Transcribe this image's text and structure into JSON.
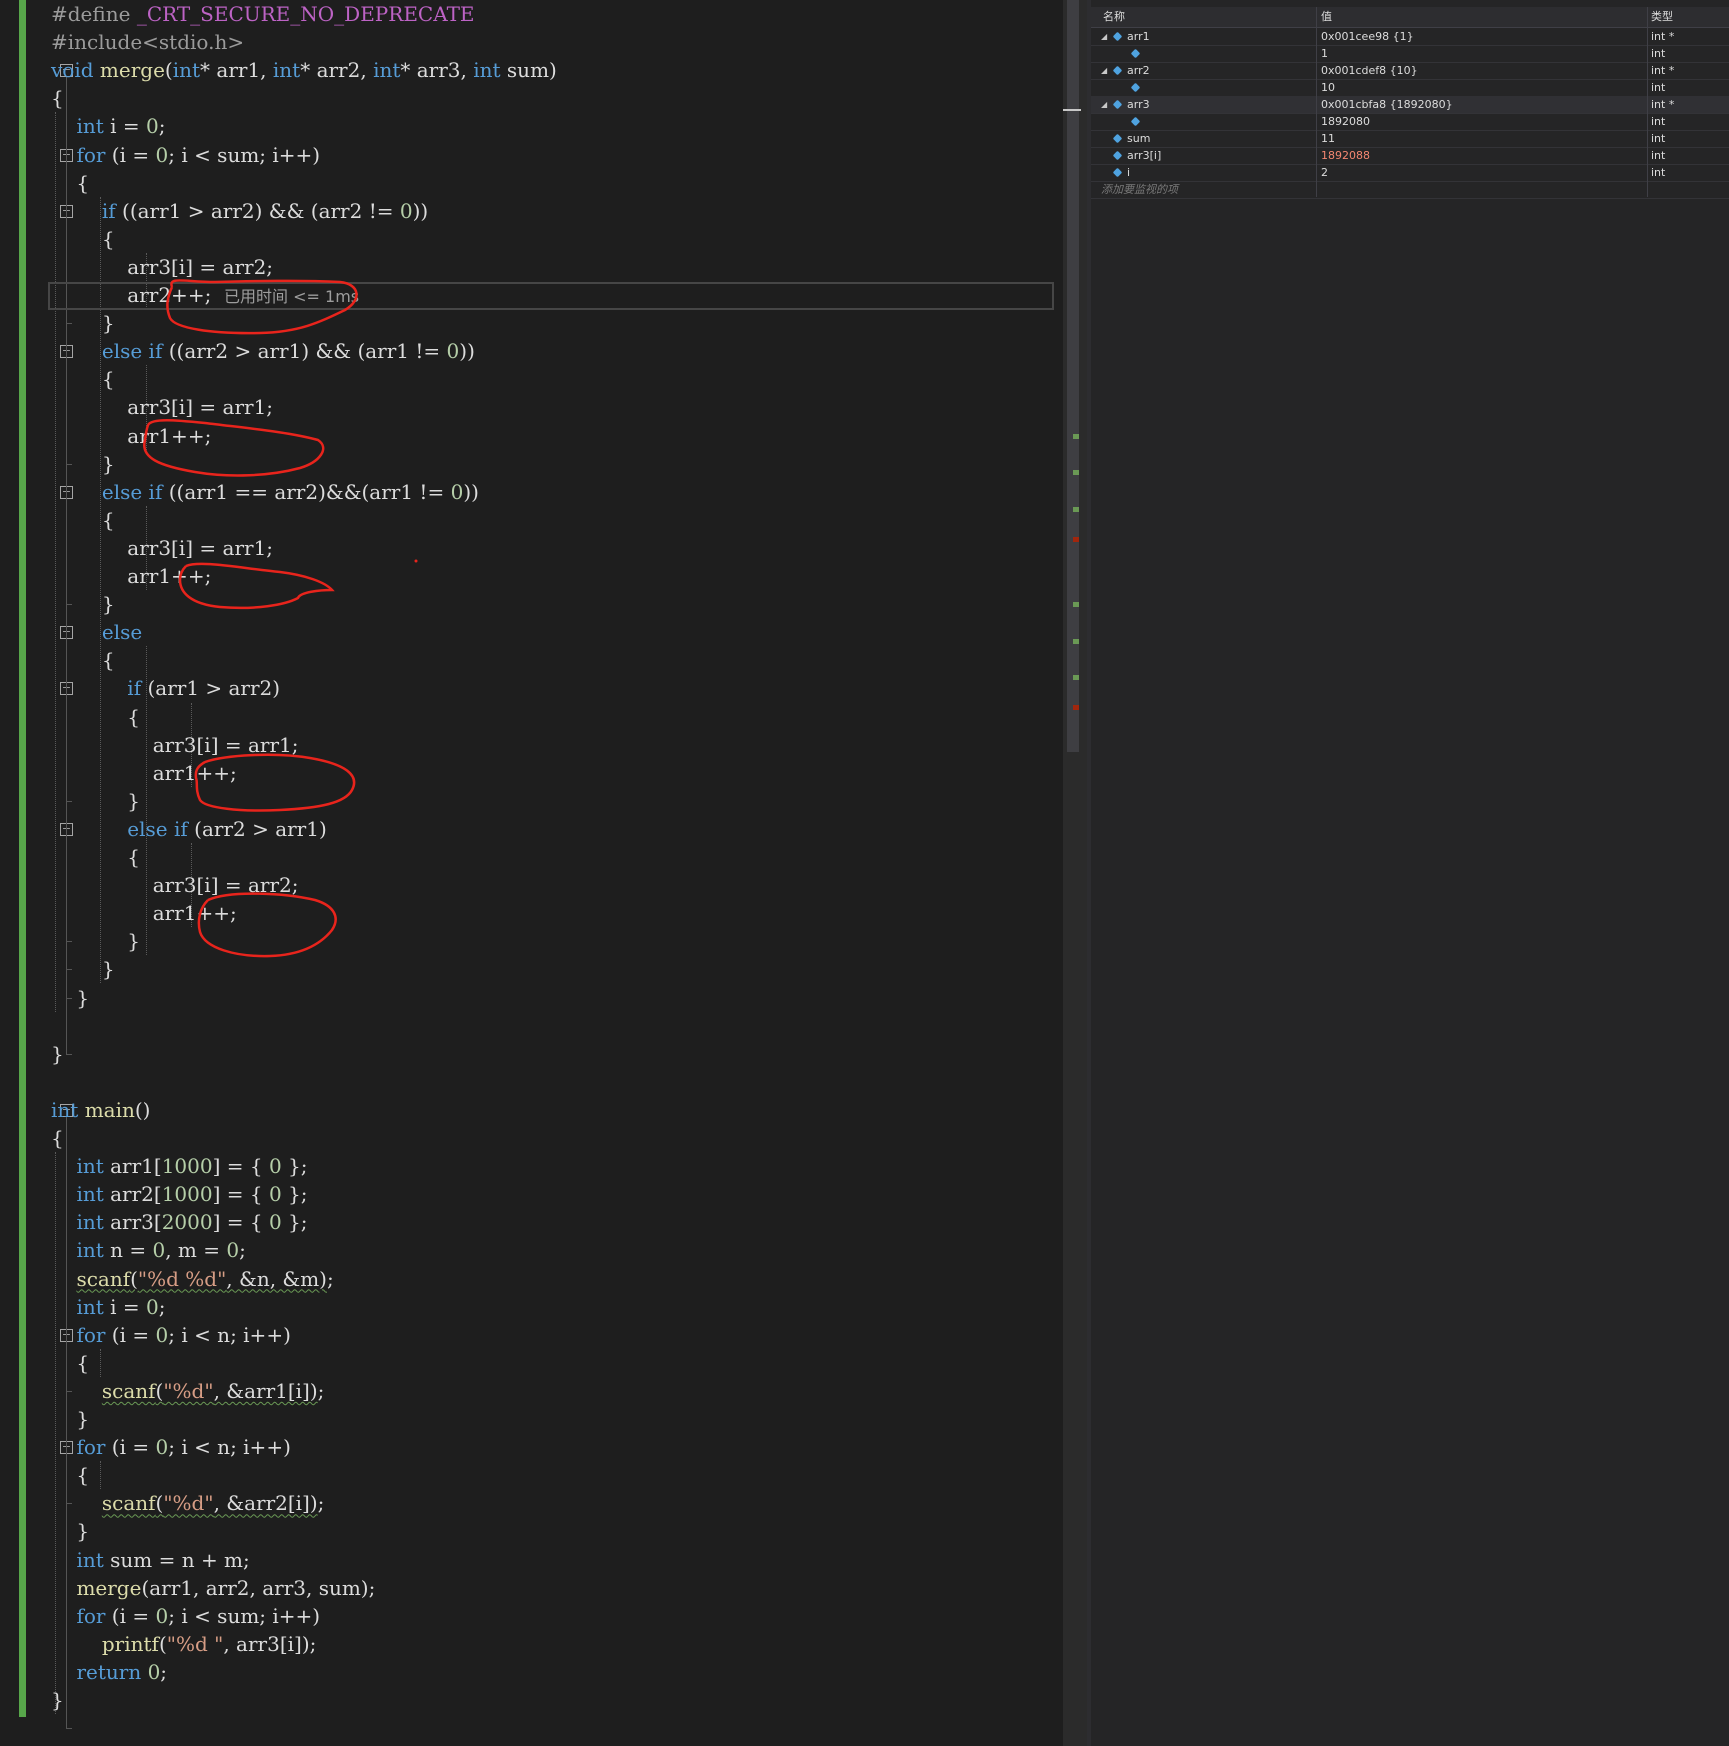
{
  "editor": {
    "lines": [
      [
        [
          "pre",
          "#define "
        ],
        [
          "macro",
          "_CRT_SECURE_NO_DEPRECATE"
        ]
      ],
      [
        [
          "pre",
          "#include<stdio.h>"
        ]
      ],
      [
        [
          "kw",
          "void"
        ],
        [
          "txt",
          " "
        ],
        [
          "fn",
          "merge"
        ],
        [
          "txt",
          "("
        ],
        [
          "kw",
          "int"
        ],
        [
          "txt",
          "* arr1, "
        ],
        [
          "kw",
          "int"
        ],
        [
          "txt",
          "* arr2, "
        ],
        [
          "kw",
          "int"
        ],
        [
          "txt",
          "* arr3, "
        ],
        [
          "kw",
          "int"
        ],
        [
          "txt",
          " sum)"
        ]
      ],
      [
        [
          "txt",
          "{"
        ]
      ],
      [
        [
          "txt",
          "    "
        ],
        [
          "kw",
          "int"
        ],
        [
          "txt",
          " i = "
        ],
        [
          "num",
          "0"
        ],
        [
          "txt",
          ";"
        ]
      ],
      [
        [
          "txt",
          "    "
        ],
        [
          "kw",
          "for"
        ],
        [
          "txt",
          " (i = "
        ],
        [
          "num",
          "0"
        ],
        [
          "txt",
          "; i < sum; i++)"
        ]
      ],
      [
        [
          "txt",
          "    {"
        ]
      ],
      [
        [
          "txt",
          "        "
        ],
        [
          "kw",
          "if"
        ],
        [
          "txt",
          " ((arr1 > arr2) && (arr2 != "
        ],
        [
          "num",
          "0"
        ],
        [
          "txt",
          "))"
        ]
      ],
      [
        [
          "txt",
          "        {"
        ]
      ],
      [
        [
          "txt",
          "            arr3[i] = arr2;"
        ]
      ],
      [
        [
          "txt",
          "            arr2++;  "
        ],
        [
          "perf",
          "已用时间 <= 1ms"
        ]
      ],
      [
        [
          "txt",
          "        }"
        ]
      ],
      [
        [
          "txt",
          "        "
        ],
        [
          "kw",
          "else if"
        ],
        [
          "txt",
          " ((arr2 > arr1) && (arr1 != "
        ],
        [
          "num",
          "0"
        ],
        [
          "txt",
          "))"
        ]
      ],
      [
        [
          "txt",
          "        {"
        ]
      ],
      [
        [
          "txt",
          "            arr3[i] = arr1;"
        ]
      ],
      [
        [
          "txt",
          "            arr1++;"
        ]
      ],
      [
        [
          "txt",
          "        }"
        ]
      ],
      [
        [
          "txt",
          "        "
        ],
        [
          "kw",
          "else if"
        ],
        [
          "txt",
          " ((arr1 == arr2)&&(arr1 != "
        ],
        [
          "num",
          "0"
        ],
        [
          "txt",
          "))"
        ]
      ],
      [
        [
          "txt",
          "        {"
        ]
      ],
      [
        [
          "txt",
          "            arr3[i] = arr1;"
        ]
      ],
      [
        [
          "txt",
          "            arr1++;"
        ]
      ],
      [
        [
          "txt",
          "        }"
        ]
      ],
      [
        [
          "txt",
          "        "
        ],
        [
          "kw",
          "else"
        ]
      ],
      [
        [
          "txt",
          "        {"
        ]
      ],
      [
        [
          "txt",
          "            "
        ],
        [
          "kw",
          "if"
        ],
        [
          "txt",
          " (arr1 > arr2)"
        ]
      ],
      [
        [
          "txt",
          "            {"
        ]
      ],
      [
        [
          "txt",
          "                arr3[i] = arr1;"
        ]
      ],
      [
        [
          "txt",
          "                arr1++;"
        ]
      ],
      [
        [
          "txt",
          "            }"
        ]
      ],
      [
        [
          "txt",
          "            "
        ],
        [
          "kw",
          "else if"
        ],
        [
          "txt",
          " (arr2 > arr1)"
        ]
      ],
      [
        [
          "txt",
          "            {"
        ]
      ],
      [
        [
          "txt",
          "                arr3[i] = arr2;"
        ]
      ],
      [
        [
          "txt",
          "                arr1++;"
        ]
      ],
      [
        [
          "txt",
          "            }"
        ]
      ],
      [
        [
          "txt",
          "        }"
        ]
      ],
      [
        [
          "txt",
          "    }"
        ]
      ],
      [
        [
          "txt",
          ""
        ]
      ],
      [
        [
          "txt",
          "}"
        ]
      ],
      [
        [
          "txt",
          ""
        ]
      ],
      [
        [
          "kw",
          "int"
        ],
        [
          "txt",
          " "
        ],
        [
          "fn",
          "main"
        ],
        [
          "txt",
          "()"
        ]
      ],
      [
        [
          "txt",
          "{"
        ]
      ],
      [
        [
          "txt",
          "    "
        ],
        [
          "kw",
          "int"
        ],
        [
          "txt",
          " arr1["
        ],
        [
          "num",
          "1000"
        ],
        [
          "txt",
          "] = { "
        ],
        [
          "num",
          "0"
        ],
        [
          "txt",
          " };"
        ]
      ],
      [
        [
          "txt",
          "    "
        ],
        [
          "kw",
          "int"
        ],
        [
          "txt",
          " arr2["
        ],
        [
          "num",
          "1000"
        ],
        [
          "txt",
          "] = { "
        ],
        [
          "num",
          "0"
        ],
        [
          "txt",
          " };"
        ]
      ],
      [
        [
          "txt",
          "    "
        ],
        [
          "kw",
          "int"
        ],
        [
          "txt",
          " arr3["
        ],
        [
          "num",
          "2000"
        ],
        [
          "txt",
          "] = { "
        ],
        [
          "num",
          "0"
        ],
        [
          "txt",
          " };"
        ]
      ],
      [
        [
          "txt",
          "    "
        ],
        [
          "kw",
          "int"
        ],
        [
          "txt",
          " n = "
        ],
        [
          "num",
          "0"
        ],
        [
          "txt",
          ", m = "
        ],
        [
          "num",
          "0"
        ],
        [
          "txt",
          ";"
        ]
      ],
      [
        [
          "txt",
          "    "
        ],
        [
          "fnsq",
          "scanf"
        ],
        [
          "sq",
          "("
        ],
        [
          "strsq",
          "\"%d %d\""
        ],
        [
          "sq",
          ", &n, &m)"
        ],
        [
          "txt",
          ";"
        ]
      ],
      [
        [
          "txt",
          "    "
        ],
        [
          "kw",
          "int"
        ],
        [
          "txt",
          " i = "
        ],
        [
          "num",
          "0"
        ],
        [
          "txt",
          ";"
        ]
      ],
      [
        [
          "txt",
          "    "
        ],
        [
          "kw",
          "for"
        ],
        [
          "txt",
          " (i = "
        ],
        [
          "num",
          "0"
        ],
        [
          "txt",
          "; i < n; i++)"
        ]
      ],
      [
        [
          "txt",
          "    {"
        ]
      ],
      [
        [
          "txt",
          "        "
        ],
        [
          "fnsq",
          "scanf"
        ],
        [
          "sq",
          "("
        ],
        [
          "strsq",
          "\"%d\""
        ],
        [
          "sq",
          ", &arr1[i])"
        ],
        [
          "txt",
          ";"
        ]
      ],
      [
        [
          "txt",
          "    }"
        ]
      ],
      [
        [
          "txt",
          "    "
        ],
        [
          "kw",
          "for"
        ],
        [
          "txt",
          " (i = "
        ],
        [
          "num",
          "0"
        ],
        [
          "txt",
          "; i < n; i++)"
        ]
      ],
      [
        [
          "txt",
          "    {"
        ]
      ],
      [
        [
          "txt",
          "        "
        ],
        [
          "fnsq",
          "scanf"
        ],
        [
          "sq",
          "("
        ],
        [
          "strsq",
          "\"%d\""
        ],
        [
          "sq",
          ", &arr2[i])"
        ],
        [
          "txt",
          ";"
        ]
      ],
      [
        [
          "txt",
          "    }"
        ]
      ],
      [
        [
          "txt",
          "    "
        ],
        [
          "kw",
          "int"
        ],
        [
          "txt",
          " sum = n + m;"
        ]
      ],
      [
        [
          "txt",
          "    "
        ],
        [
          "fn",
          "merge"
        ],
        [
          "txt",
          "(arr1, arr2, arr3, sum);"
        ]
      ],
      [
        [
          "txt",
          "    "
        ],
        [
          "kw",
          "for"
        ],
        [
          "txt",
          " (i = "
        ],
        [
          "num",
          "0"
        ],
        [
          "txt",
          "; i < sum; i++)"
        ]
      ],
      [
        [
          "txt",
          "        "
        ],
        [
          "fn",
          "printf"
        ],
        [
          "txt",
          "("
        ],
        [
          "str",
          "\"%d \""
        ],
        [
          "txt",
          ", arr3[i]);"
        ]
      ],
      [
        [
          "txt",
          "    "
        ],
        [
          "kw",
          "return"
        ],
        [
          "txt",
          " "
        ],
        [
          "num",
          "0"
        ],
        [
          "txt",
          ";"
        ]
      ],
      [
        [
          "txt",
          "}"
        ]
      ]
    ]
  },
  "watch": {
    "headers": {
      "name": "名称",
      "value": "值",
      "type": "类型"
    },
    "rows": [
      {
        "name": "arr1",
        "value": "0x001cee98 {1}",
        "type": "int *",
        "expanded": true,
        "level": 0
      },
      {
        "name": "",
        "value": "1",
        "type": "int",
        "level": 1
      },
      {
        "name": "arr2",
        "value": "0x001cdef8 {10}",
        "type": "int *",
        "expanded": true,
        "level": 0
      },
      {
        "name": "",
        "value": "10",
        "type": "int",
        "level": 1
      },
      {
        "name": "arr3",
        "value": "0x001cbfa8 {1892080}",
        "type": "int *",
        "expanded": true,
        "level": 0,
        "selected": true
      },
      {
        "name": "",
        "value": "1892080",
        "type": "int",
        "level": 1
      },
      {
        "name": "sum",
        "value": "11",
        "type": "int",
        "level": 0
      },
      {
        "name": "arr3[i]",
        "value": "1892088",
        "type": "int",
        "level": 0,
        "changed": true
      },
      {
        "name": "i",
        "value": "2",
        "type": "int",
        "level": 0
      }
    ],
    "add_item_placeholder": "添加要监视的项"
  }
}
